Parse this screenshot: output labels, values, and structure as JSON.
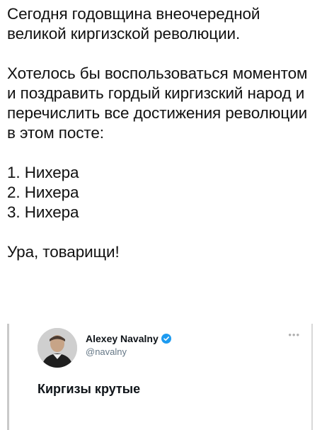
{
  "post": {
    "paragraph1": "Сегодня годовщина внеочередной великой киргизской революции.",
    "paragraph2": "Хотелось бы воспользоваться моментом и поздравить гордый киргизский народ и перечислить все достижения революции в этом посте:",
    "list": [
      "1. Нихера",
      "2. Нихера",
      "3. Нихера"
    ],
    "closing": "Ура, товарищи!"
  },
  "embedded_tweet": {
    "author_name": "Alexey Navalny",
    "handle": "@navalny",
    "text": "Киргизы крутые",
    "verified_badge_color": "#1d9bf0",
    "avatar_icon": "profile-photo",
    "more_icon": "ellipsis-icon"
  },
  "colors": {
    "text": "#111111",
    "handle": "#657786",
    "embed_border": "#c9c9c9"
  }
}
